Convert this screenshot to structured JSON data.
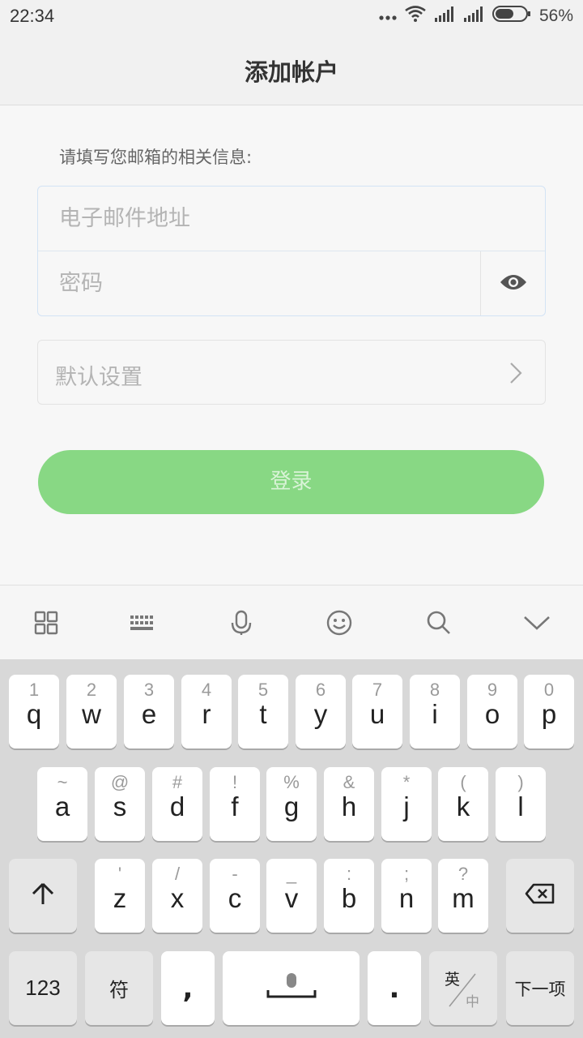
{
  "status_bar": {
    "time": "22:34",
    "battery": "56%",
    "icons": [
      "more-dots-icon",
      "wifi-icon",
      "signal-icon",
      "signal-icon",
      "battery-icon"
    ]
  },
  "header": {
    "title": "添加帐户"
  },
  "form": {
    "hint": "请填写您邮箱的相关信息:",
    "email_placeholder": "电子邮件地址",
    "password_placeholder": "密码",
    "default_settings_label": "默认设置",
    "login_label": "登录"
  },
  "toolbar_icons": [
    "grid-icon",
    "keyboard-icon",
    "microphone-icon",
    "emoji-icon",
    "search-icon",
    "chevron-down-icon"
  ],
  "keyboard": {
    "row1": [
      {
        "top": "1",
        "main": "q"
      },
      {
        "top": "2",
        "main": "w"
      },
      {
        "top": "3",
        "main": "e"
      },
      {
        "top": "4",
        "main": "r"
      },
      {
        "top": "5",
        "main": "t"
      },
      {
        "top": "6",
        "main": "y"
      },
      {
        "top": "7",
        "main": "u"
      },
      {
        "top": "8",
        "main": "i"
      },
      {
        "top": "9",
        "main": "o"
      },
      {
        "top": "0",
        "main": "p"
      }
    ],
    "row2": [
      {
        "top": "~",
        "main": "a"
      },
      {
        "top": "@",
        "main": "s"
      },
      {
        "top": "#",
        "main": "d"
      },
      {
        "top": "!",
        "main": "f"
      },
      {
        "top": "%",
        "main": "g"
      },
      {
        "top": "&",
        "main": "h"
      },
      {
        "top": "*",
        "main": "j"
      },
      {
        "top": "(",
        "main": "k"
      },
      {
        "top": ")",
        "main": "l"
      }
    ],
    "row3": [
      {
        "top": "'",
        "main": "z"
      },
      {
        "top": "/",
        "main": "x"
      },
      {
        "top": "-",
        "main": "c"
      },
      {
        "top": "_",
        "main": "v"
      },
      {
        "top": ":",
        "main": "b"
      },
      {
        "top": ";",
        "main": "n"
      },
      {
        "top": "?",
        "main": "m"
      }
    ],
    "num_label": "123",
    "symbol_label": "符",
    "comma_label": ",",
    "period_label": ".",
    "lang_top": "英",
    "lang_bottom": "中",
    "next_label": "下一项"
  }
}
